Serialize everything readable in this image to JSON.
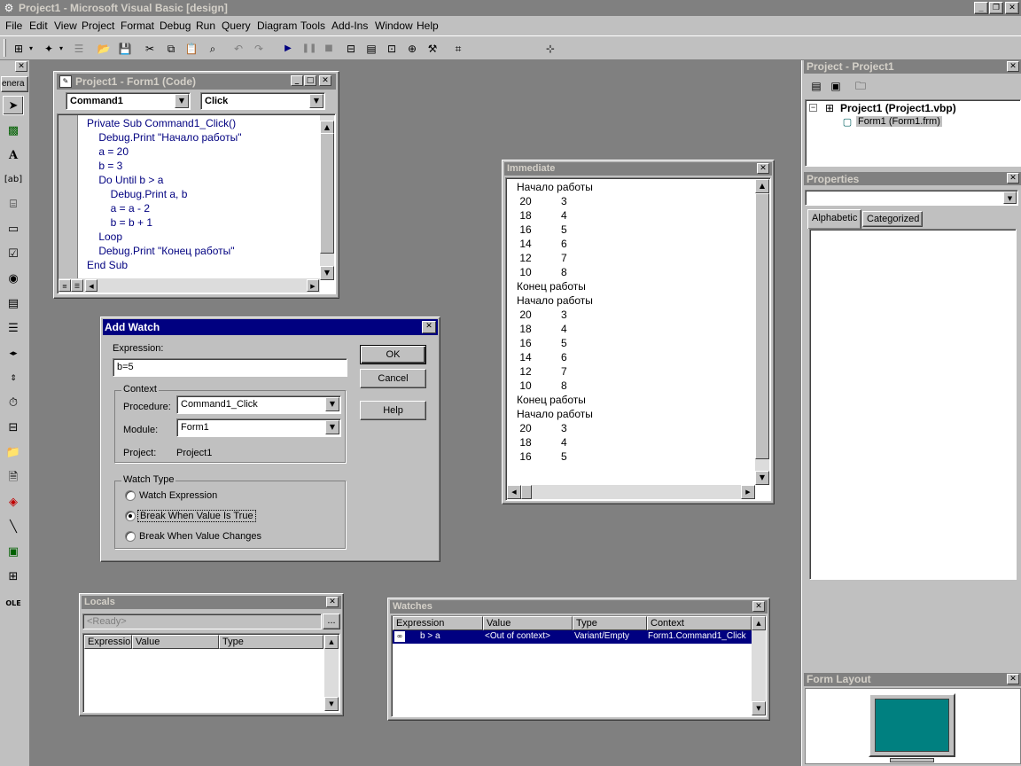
{
  "app": {
    "title": "Project1 - Microsoft Visual Basic [design]",
    "window_buttons": {
      "min": "_",
      "restore": "❐",
      "close": "✕"
    }
  },
  "menu": [
    "File",
    "Edit",
    "View",
    "Project",
    "Format",
    "Debug",
    "Run",
    "Query",
    "Diagram",
    "Tools",
    "Add-Ins",
    "Window",
    "Help"
  ],
  "toolbox": {
    "tab_label": "enera"
  },
  "code_window": {
    "title": "Project1 - Form1 (Code)",
    "object_combo": "Command1",
    "proc_combo": "Click",
    "lines": [
      "Private Sub Command1_Click()",
      "    Debug.Print \"Начало работы\"",
      "    a = 20",
      "    b = 3",
      "    Do Until b > a",
      "        Debug.Print a, b",
      "        a = a - 2",
      "        b = b + 1",
      "    Loop",
      "    Debug.Print \"Конец работы\"",
      "End Sub"
    ]
  },
  "immediate": {
    "title": "Immediate",
    "lines": [
      "Начало работы",
      " 20          3",
      " 18          4",
      " 16          5",
      " 14          6",
      " 12          7",
      " 10          8",
      "Конец работы",
      "Начало работы",
      " 20          3",
      " 18          4",
      " 16          5",
      " 14          6",
      " 12          7",
      " 10          8",
      "Конец работы",
      "Начало работы",
      " 20          3",
      " 18          4",
      " 16          5"
    ]
  },
  "add_watch": {
    "title": "Add Watch",
    "expression_label": "Expression:",
    "expression_value": "b=5",
    "context_label": "Context",
    "procedure_label": "Procedure:",
    "procedure_value": "Command1_Click",
    "module_label": "Module:",
    "module_value": "Form1",
    "project_label": "Project:",
    "project_value": "Project1",
    "watch_type_label": "Watch Type",
    "options": [
      "Watch Expression",
      "Break When Value Is True",
      "Break When Value Changes"
    ],
    "selected_option": 1,
    "ok": "OK",
    "cancel": "Cancel",
    "help": "Help"
  },
  "locals": {
    "title": "Locals",
    "status": "<Ready>",
    "ellipsis": "...",
    "columns": [
      "Expressio",
      "Value",
      "Type"
    ]
  },
  "watches": {
    "title": "Watches",
    "columns": [
      "Expression",
      "Value",
      "Type",
      "Context"
    ],
    "rows": [
      {
        "expression": "b > a",
        "value": "<Out of context>",
        "type": "Variant/Empty",
        "context": "Form1.Command1_Click"
      }
    ]
  },
  "project_explorer": {
    "title": "Project - Project1",
    "root": "Project1 (Project1.vbp)",
    "child": "Form1 (Form1.frm)"
  },
  "properties": {
    "title": "Properties",
    "tabs": [
      "Alphabetic",
      "Categorized"
    ]
  },
  "form_layout": {
    "title": "Form Layout",
    "screen_color": "#008080"
  },
  "colors": {
    "titlebar_active": "#000080",
    "face": "#c0c0c0",
    "desktop": "#808080"
  }
}
